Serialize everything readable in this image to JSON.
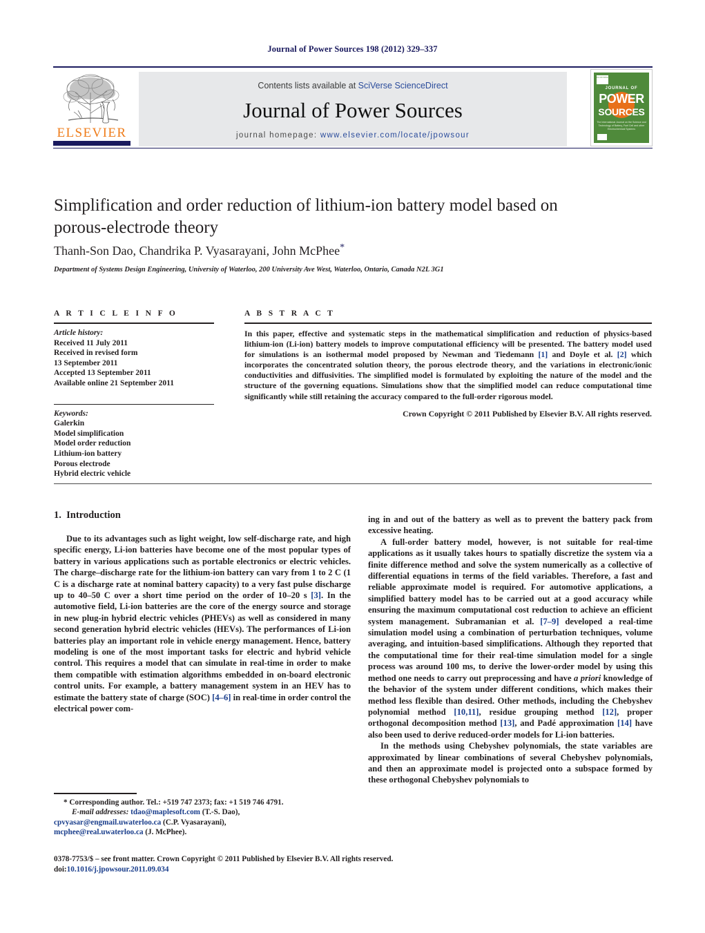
{
  "running_head": "Journal of Power Sources 198 (2012) 329–337",
  "masthead": {
    "contents_prefix": "Contents lists available at ",
    "contents_link": "SciVerse ScienceDirect",
    "journal_title": "Journal of Power Sources",
    "homepage_prefix": "journal homepage: ",
    "homepage_url": "www.elsevier.com/locate/jpowsour",
    "publisher_logo_text": "ELSEVIER",
    "cover": {
      "line1": "JOURNAL OF",
      "line2": "POWER",
      "line3": "SOURCES",
      "subtitle": "The International Journal on the Science and Technology of Battery, Fuel Cell and other Electrochemical Systems",
      "badge": "ELSEVIER",
      "background_color": "#4f8a3b",
      "accent_color": "#e8701a"
    }
  },
  "article": {
    "title": "Simplification and order reduction of lithium-ion battery model based on porous-electrode theory",
    "authors": "Thanh-Son Dao, Chandrika P. Vyasarayani, John McPhee",
    "corresponding_marker": "*",
    "affiliation": "Department of Systems Design Engineering, University of Waterloo, 200 University Ave West, Waterloo, Ontario, Canada N2L 3G1"
  },
  "article_info": {
    "heading": "A R T I C L E    I N F O",
    "history_label": "Article history:",
    "history": [
      "Received 11 July 2011",
      "Received in revised form",
      "13 September 2011",
      "Accepted 13 September 2011",
      "Available online 21 September 2011"
    ],
    "keywords_label": "Keywords:",
    "keywords": [
      "Galerkin",
      "Model simplification",
      "Model order reduction",
      "Lithium-ion battery",
      "Porous electrode",
      "Hybrid electric vehicle"
    ]
  },
  "abstract": {
    "heading": "A B S T R A C T",
    "part1": "In this paper, effective and systematic steps in the mathematical simplification and reduction of physics-based lithium-ion (Li-ion) battery models to improve computational efficiency will be presented. The battery model used for simulations is an isothermal model proposed by Newman and Tiedemann ",
    "ref1": "[1]",
    "part2": " and Doyle et al. ",
    "ref2": "[2]",
    "part3": " which incorporates the concentrated solution theory, the porous electrode theory, and the variations in electronic/ionic conductivities and diffusivities. The simplified model is formulated by exploiting the nature of the model and the structure of the governing equations. Simulations show that the simplified model can reduce computational time significantly while still retaining the accuracy compared to the full-order rigorous model.",
    "copyright": "Crown Copyright © 2011 Published by Elsevier B.V. All rights reserved."
  },
  "section": {
    "number": "1.",
    "heading": "Introduction"
  },
  "body_left": {
    "p1_a": "Due to its advantages such as light weight, low self-discharge rate, and high specific energy, Li-ion batteries have become one of the most popular types of battery in various applications such as portable electronics or electric vehicles. The charge–discharge rate for the lithium-ion battery can vary from 1 to 2 C (1 C is a discharge rate at nominal battery capacity) to a very fast pulse discharge up to 40–50 C over a short time period on the order of 10–20 s ",
    "p1_ref": "[3]",
    "p1_b": ". In the automotive field, Li-ion batteries are the core of the energy source and storage in new plug-in hybrid electric vehicles (PHEVs) as well as considered in many second generation hybrid electric vehicles (HEVs). The performances of Li-ion batteries play an important role in vehicle energy management. Hence, battery modeling is one of the most important tasks for electric and hybrid vehicle control. This requires a model that can simulate in real-time in order to make them compatible with estimation algorithms embedded in on-board electronic control units. For example, a battery management system in an HEV has to estimate the battery state of charge (SOC) ",
    "p1_ref2": "[4–6]",
    "p1_c": " in real-time in order control the electrical power com-"
  },
  "body_right": {
    "p0": "ing in and out of the battery as well as to prevent the battery pack from excessive heating.",
    "p1_a": "A full-order battery model, however, is not suitable for real-time applications as it usually takes hours to spatially discretize the system via a finite difference method and solve the system numerically as a collective of differential equations in terms of the field variables. Therefore, a fast and reliable approximate model is required. For automotive applications, a simplified battery model has to be carried out at a good accuracy while ensuring the maximum computational cost reduction to achieve an efficient system management. Subramanian et al. ",
    "p1_ref1": "[7–9]",
    "p1_b": " developed a real-time simulation model using a combination of perturbation techniques, volume averaging, and intuition-based simplifications. Although they reported that the computational time for their real-time simulation model for a single process was around 100 ms, to derive the lower-order model by using this method one needs to carry out preprocessing and have ",
    "p1_ital": "a priori",
    "p1_c": " knowledge of the behavior of the system under different conditions, which makes their method less flexible than desired. Other methods, including the Chebyshev polynomial method ",
    "p1_ref2": "[10,11]",
    "p1_d": ", residue grouping method ",
    "p1_ref3": "[12]",
    "p1_e": ", proper orthogonal decomposition method ",
    "p1_ref4": "[13]",
    "p1_f": ", and Padé approximation ",
    "p1_ref5": "[14]",
    "p1_g": " have also been used to derive reduced-order models for Li-ion batteries.",
    "p2": "In the methods using Chebyshev polynomials, the state variables are approximated by linear combinations of several Chebyshev polynomials, and then an approximate model is projected onto a subspace formed by these orthogonal Chebyshev polynomials to"
  },
  "footnotes": {
    "corresponding": "* Corresponding author. Tel.: +519 747 2373; fax: +1 519 746 4791.",
    "email_label": "E-mail addresses:",
    "email1": "tdao@maplesoft.com",
    "email1_name": " (T.-S. Dao),",
    "email2": "cpvyasar@engmail.uwaterloo.ca",
    "email2_name": " (C.P. Vyasarayani),",
    "email3": "mcphee@real.uwaterloo.ca",
    "email3_name": " (J. McPhee)."
  },
  "imprint": {
    "line1": "0378-7753/$ – see front matter. Crown Copyright © 2011 Published by Elsevier B.V. All rights reserved.",
    "doi_label": "doi:",
    "doi": "10.1016/j.jpowsour.2011.09.034"
  }
}
